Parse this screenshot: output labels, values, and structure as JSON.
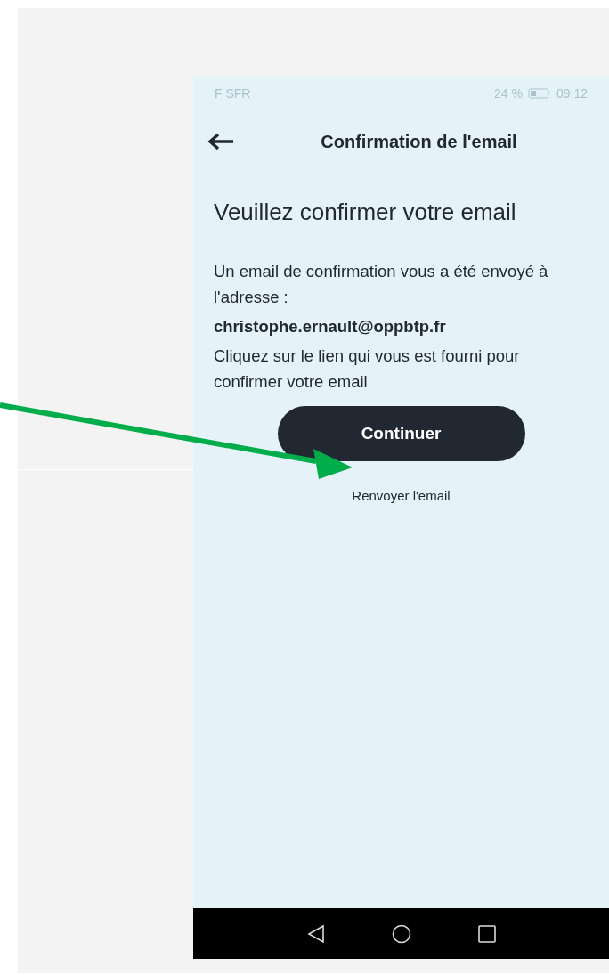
{
  "status_bar": {
    "carrier": "F SFR",
    "battery": "24 %",
    "time": "09:12"
  },
  "header": {
    "title": "Confirmation de l'email"
  },
  "heading": "Veuillez confirmer votre email",
  "message": "Un email de confirmation vous a été envoyé à l'adresse :",
  "email": "christophe.ernault@oppbtp.fr",
  "instruction": "Cliquez sur le lien qui vous est fourni pour confirmer votre email",
  "primary_button": "Continuer",
  "resend_link": "Renvoyer l'email"
}
